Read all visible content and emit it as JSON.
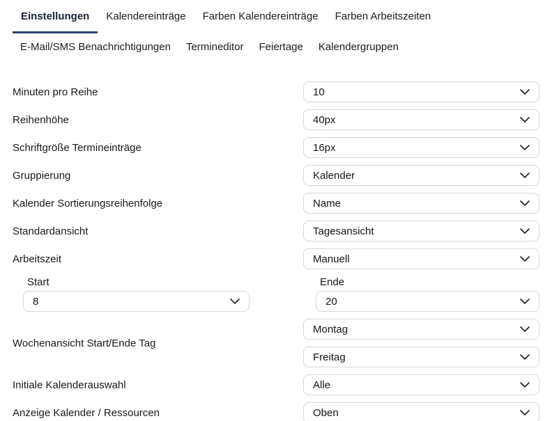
{
  "page": {
    "accent_underline_color": "#2e4272",
    "text_color": "#1a1a1a",
    "select_border_color": "#d6d6d6"
  },
  "icons": {
    "dropdown_chevron": "chevron-down"
  },
  "tabs": {
    "row1": [
      {
        "label": "Einstellungen",
        "active": true
      },
      {
        "label": "Kalendereinträge",
        "active": false
      },
      {
        "label": "Farben Kalendereinträge",
        "active": false
      },
      {
        "label": "Farben Arbeitszeiten",
        "active": false
      }
    ],
    "row2": [
      {
        "label": "E-Mail/SMS Benachrichtigungen",
        "active": false
      },
      {
        "label": "Termineditor",
        "active": false
      },
      {
        "label": "Feiertage",
        "active": false
      },
      {
        "label": "Kalendergruppen",
        "active": false
      }
    ]
  },
  "form": {
    "rows": [
      {
        "label": "Minuten pro Reihe",
        "value": "10"
      },
      {
        "label": "Reihenhöhe",
        "value": "40px"
      },
      {
        "label": "Schriftgröße Termineinträge",
        "value": "16px"
      },
      {
        "label": "Gruppierung",
        "value": "Kalender"
      },
      {
        "label": "Kalender Sortierungsreihenfolge",
        "value": "Name"
      },
      {
        "label": "Standardansicht",
        "value": "Tagesansicht"
      },
      {
        "label": "Arbeitszeit",
        "value": "Manuell"
      }
    ],
    "worktime": {
      "start_label": "Start",
      "start_value": "8",
      "end_label": "Ende",
      "end_value": "20"
    },
    "week_view": {
      "label": "Wochenansicht Start/Ende Tag",
      "start_value": "Montag",
      "end_value": "Freitag"
    },
    "initial_selection": {
      "label": "Initiale Kalenderauswahl",
      "value": "Alle"
    },
    "display_position": {
      "label": "Anzeige Kalender / Ressourcen",
      "value": "Oben"
    }
  }
}
